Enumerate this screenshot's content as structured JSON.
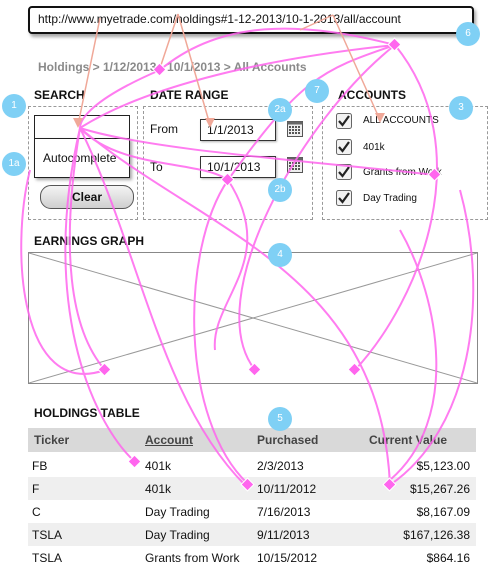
{
  "browser": {
    "url": "http://www.myetrade.com/holdings#1-12-2013/10-1-2013/all/account"
  },
  "breadcrumb": "Holdings > 1/12/2013 - 10/1/2013 > All Accounts",
  "search": {
    "heading": "SEARCH",
    "input_value": "",
    "autocomplete_text": "Autocomplete",
    "clear_label": "Clear"
  },
  "date_range": {
    "heading": "DATE RANGE",
    "from_label": "From",
    "from_value": "1/1/2013",
    "to_label": "To",
    "to_value": "10/1/2013"
  },
  "accounts": {
    "heading": "ACCOUNTS",
    "items": [
      {
        "label": "ALL ACCOUNTS",
        "checked": true
      },
      {
        "label": "401k",
        "checked": true
      },
      {
        "label": "Grants from Work",
        "checked": true
      },
      {
        "label": "Day Trading",
        "checked": true
      }
    ]
  },
  "earnings_graph": {
    "heading": "EARNINGS GRAPH"
  },
  "holdings_table": {
    "heading": "HOLDINGS TABLE",
    "columns": [
      "Ticker",
      "Account",
      "Purchased",
      "Current Value"
    ],
    "rows": [
      [
        "FB",
        "401k",
        "2/3/2013",
        "$5,123.00"
      ],
      [
        "F",
        "401k",
        "10/11/2012",
        "$15,267.26"
      ],
      [
        "C",
        "Day Trading",
        "7/16/2013",
        "$8,167.09"
      ],
      [
        "TSLA",
        "Day Trading",
        "9/11/2013",
        "$167,126.38"
      ],
      [
        "TSLA",
        "Grants from Work",
        "10/15/2012",
        "$864.16"
      ]
    ]
  },
  "annotations": [
    "1",
    "1a",
    "2a",
    "2b",
    "3",
    "4",
    "5",
    "6",
    "7"
  ],
  "colors": {
    "annotation_badge": "#7fd0f5",
    "annotation_line": "#ff66ee",
    "header_bg": "#d9d9d9"
  }
}
